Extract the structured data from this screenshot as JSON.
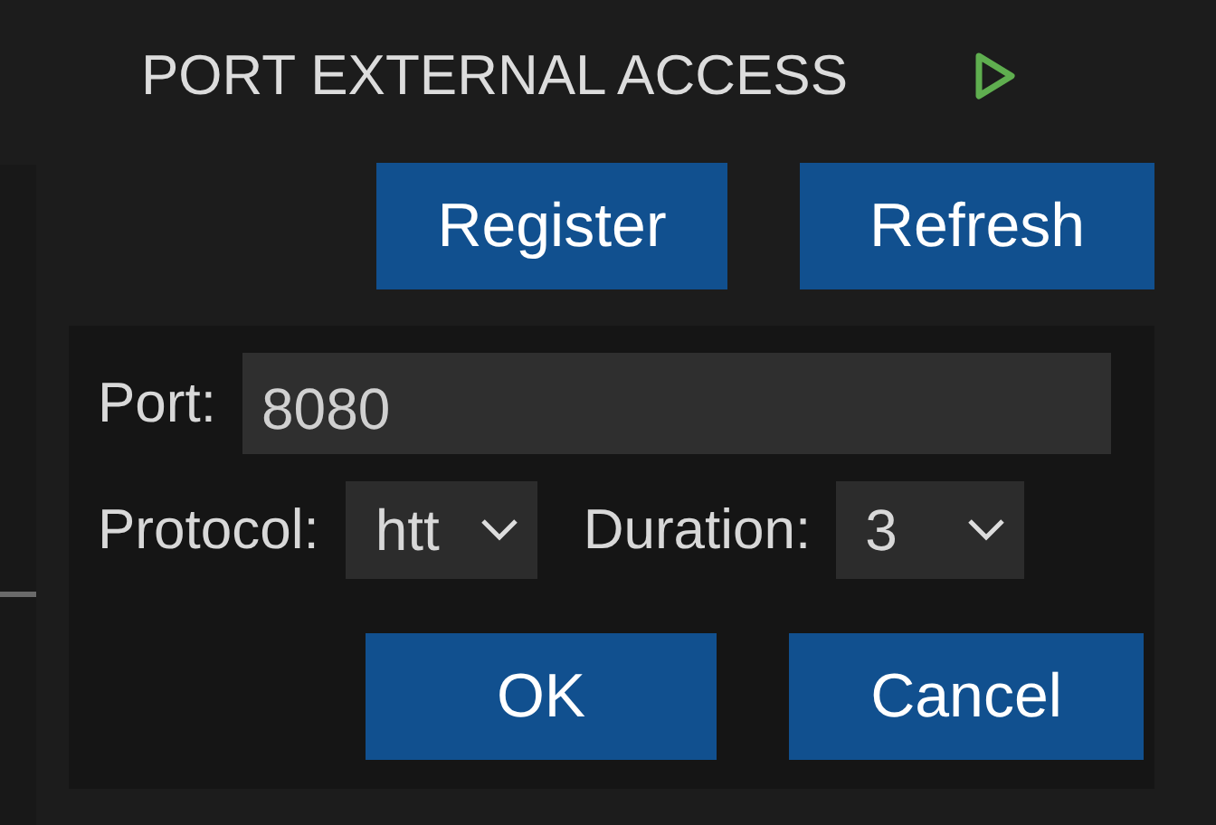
{
  "header": {
    "title": "PORT EXTERNAL ACCESS"
  },
  "toolbar": {
    "buttons": [
      "Register",
      "Refresh"
    ]
  },
  "form": {
    "port": {
      "label": "Port:",
      "value": "8080"
    },
    "protocol": {
      "label": "Protocol:",
      "value": "htt"
    },
    "duration": {
      "label": "Duration:",
      "value": "3"
    }
  },
  "actions": [
    "OK",
    "Cancel"
  ]
}
